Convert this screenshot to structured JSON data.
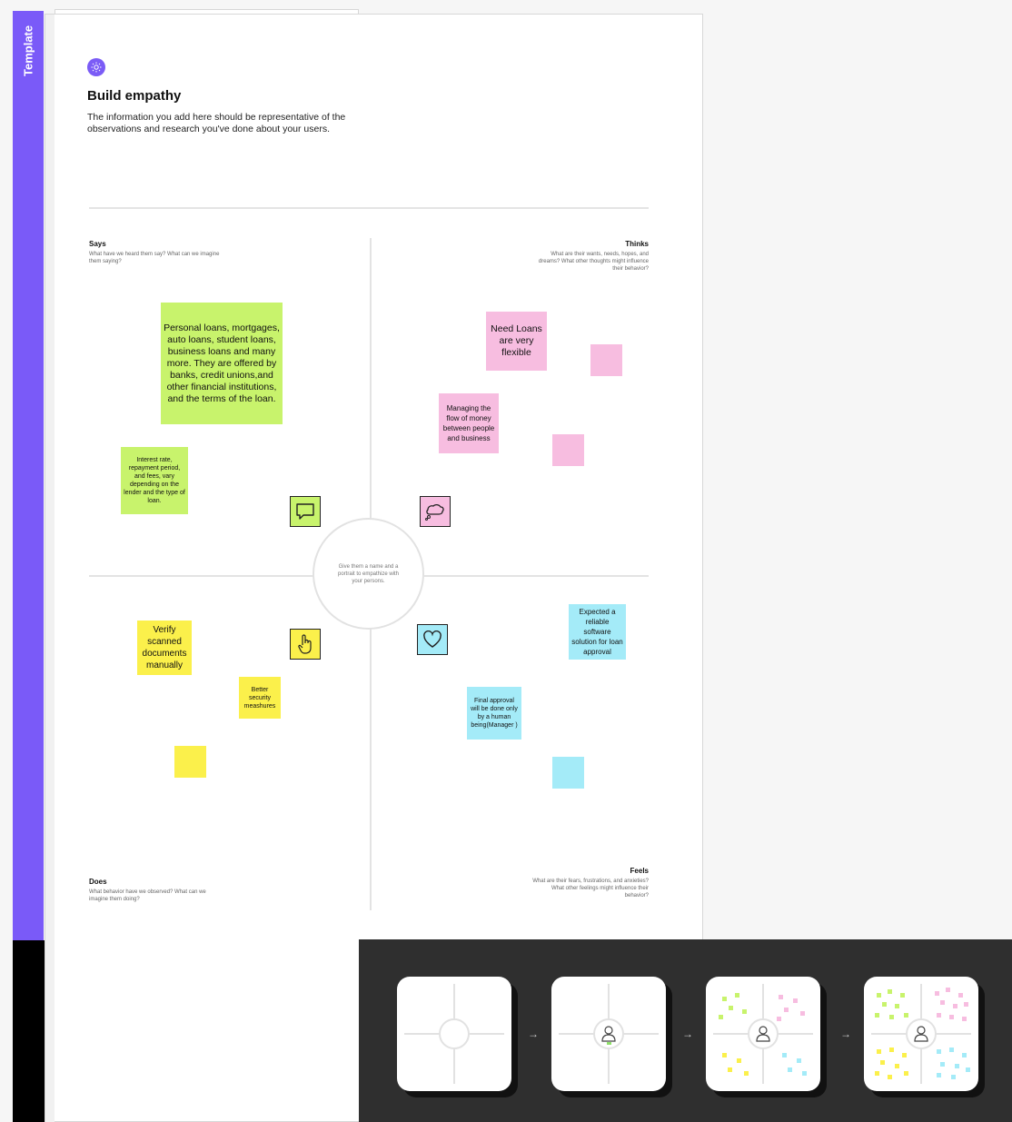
{
  "sidebar": {
    "label": "Template"
  },
  "header": {
    "icon": "sun-icon",
    "title": "Build empathy",
    "description": "The information you add here should be representative of the observations and research you've done about your users."
  },
  "quadrants": {
    "says": {
      "title": "Says",
      "subtitle": "What have we heard them say? What can we imagine them saying?"
    },
    "thinks": {
      "title": "Thinks",
      "subtitle": "What are their wants, needs, hopes, and dreams? What other thoughts might influence their behavior?"
    },
    "does": {
      "title": "Does",
      "subtitle": "What behavior have we observed? What can we imagine them doing?"
    },
    "feels": {
      "title": "Feels",
      "subtitle": "What are their fears, frustrations, and anxieties? What other feelings might influence their behavior?"
    }
  },
  "center": {
    "text": "Give them a name and a portrait to empathize with your persons."
  },
  "notes": {
    "says_1": "Personal loans, mortgages, auto loans, student loans, business loans and many more. They are offered by banks, credit unions,and other financial institutions, and the terms of the loan.",
    "says_2": "Interest rate, repayment period, and fees, vary depending on the lender and the type of loan.",
    "thinks_1": "Need Loans are very flexible",
    "thinks_2": "Managing the flow of money between people and business",
    "does_1": "Verify scanned documents manually",
    "does_2": "Better security meashures",
    "feels_1": "Expected a reliable software solution for loan approval",
    "feels_2": "Final approval will be done only by a human being(Manager )"
  },
  "icons": {
    "says": "speech-bubble-icon",
    "thinks": "thought-bubble-icon",
    "does": "pointing-hand-icon",
    "feels": "heart-icon",
    "steps_arrow": "arrow-right-icon",
    "persona": "person-icon"
  },
  "colors": {
    "sidebar": "#7a5af8",
    "says": "#c8f36c",
    "thinks": "#f7bde0",
    "does": "#fbf04b",
    "feels": "#a4ebf8",
    "steps_background": "#2f2f2f"
  },
  "steps": {
    "arrow": "→",
    "count": 4
  }
}
